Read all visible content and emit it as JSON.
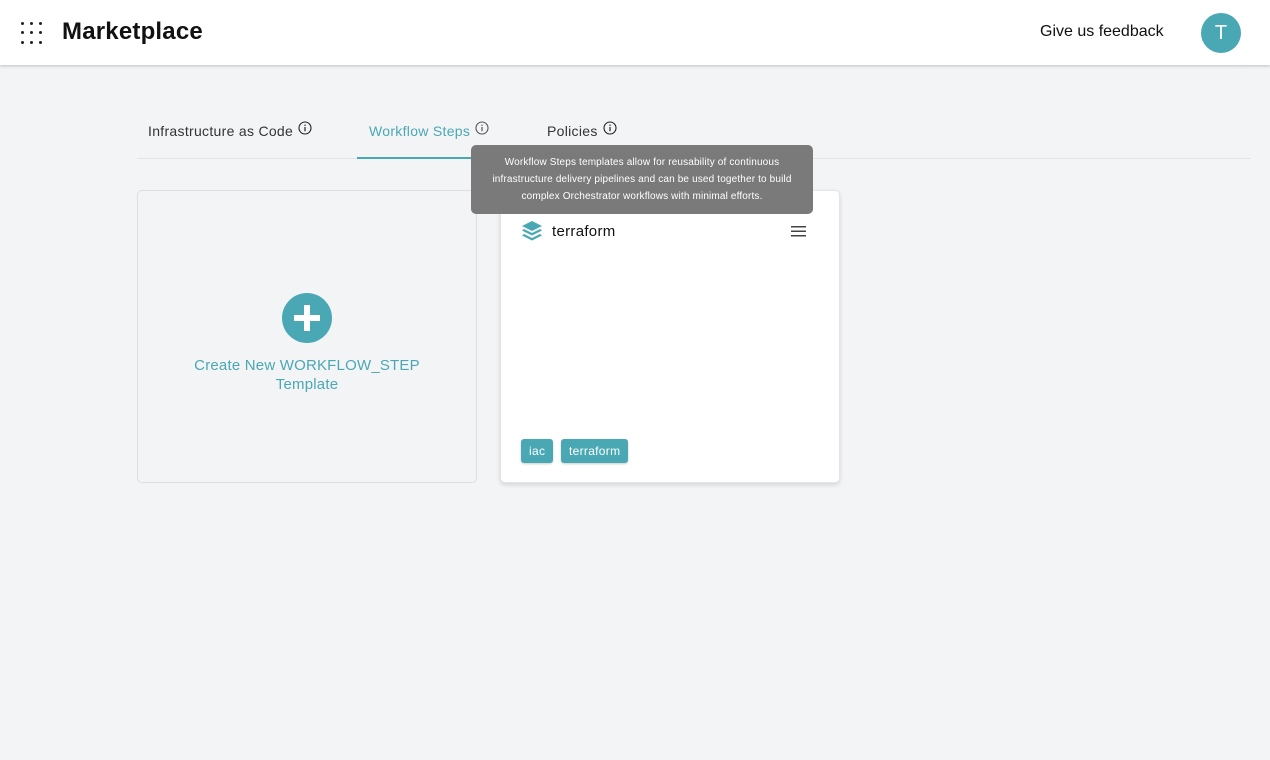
{
  "header": {
    "title": "Marketplace",
    "feedback_label": "Give us feedback",
    "avatar_initial": "T"
  },
  "tabs": [
    {
      "label": "Infrastructure as Code",
      "icon": "info-icon",
      "active": false
    },
    {
      "label": "Workflow Steps",
      "icon": "info-icon",
      "active": true
    },
    {
      "label": "Policies",
      "icon": "info-icon",
      "active": false
    }
  ],
  "tooltip": {
    "line1": "Workflow Steps templates allow for reusability of continuous",
    "line2": "infrastructure delivery pipelines and can be used together to build",
    "line3": "complex Orchestrator workflows with minimal efforts."
  },
  "create_card": {
    "icon": "plus-circle-icon",
    "label_line1": "Create New WORKFLOW_STEP",
    "label_line2": "Template"
  },
  "template_card": {
    "icon": "layers-icon",
    "name": "terraform",
    "menu_icon": "hamburger-menu-icon",
    "tags": [
      "iac",
      "terraform"
    ]
  },
  "colors": {
    "accent": "#4aa8b4",
    "background": "#f3f4f6",
    "tooltip": "#7a7a7a"
  }
}
